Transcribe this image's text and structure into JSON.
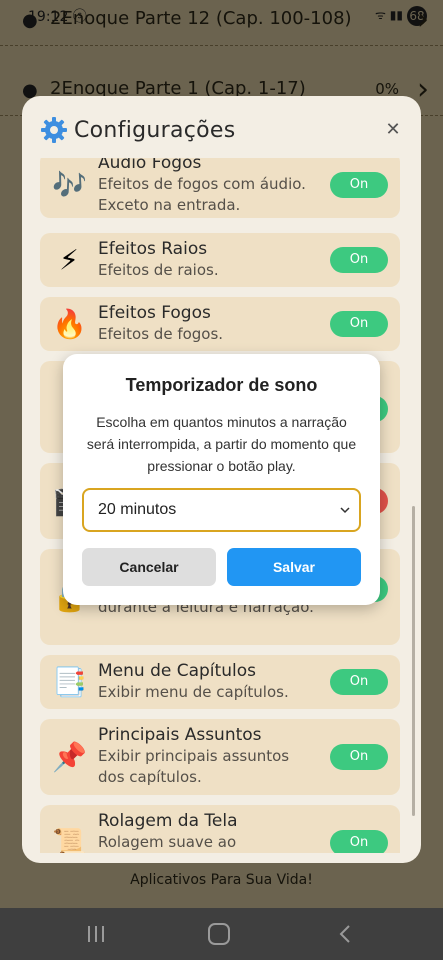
{
  "status_bar": {
    "time": "19:12 ⓢ",
    "icons": "ᯤ ▮▮",
    "battery": "68"
  },
  "background_list": [
    {
      "title": "2Enoque Parte 12 (Cap. 100-108)",
      "percent": ""
    },
    {
      "title": "2Enoque Parte 1 (Cap. 1-17)",
      "percent": "0%"
    }
  ],
  "footer_text": "Aplicativos Para Sua Vida!",
  "settings": {
    "title": "Configurações",
    "close_symbol": "✕",
    "items": [
      {
        "icon": "🎶",
        "name": "Áudio Fogos",
        "desc": "Efeitos de fogos com áudio. Exceto na entrada.",
        "toggle": "On"
      },
      {
        "icon": "⚡",
        "name": "Efeitos Raios",
        "desc": "Efeitos de raios.",
        "toggle": "On"
      },
      {
        "icon": "🔥",
        "name": "Efeitos Fogos",
        "desc": "Efeitos de fogos.",
        "toggle": "On"
      },
      {
        "icon": "",
        "name": "",
        "desc": "",
        "toggle": "On"
      },
      {
        "icon": "🎬",
        "name": "",
        "desc": "",
        "toggle": ""
      },
      {
        "icon": "🔒",
        "name": "",
        "desc": "durante a leitura e narração.",
        "toggle": "On"
      },
      {
        "icon": "📑",
        "name": "Menu de Capítulos",
        "desc": "Exibir menu de capítulos.",
        "toggle": "On"
      },
      {
        "icon": "📌",
        "name": "Principais Assuntos",
        "desc": "Exibir principais assuntos dos capítulos.",
        "toggle": "On"
      },
      {
        "icon": "📜",
        "name": "Rolagem da Tela",
        "desc": "Rolagem suave ao",
        "toggle": "On"
      }
    ]
  },
  "sleep_timer": {
    "title": "Temporizador de sono",
    "description": "Escolha em quantos minutos a narração será interrompida, a partir do momento que pressionar o botão play.",
    "selected_value": "20 minutos",
    "cancel_label": "Cancelar",
    "save_label": "Salvar"
  },
  "colors": {
    "toggle_on": "#3dc980",
    "save_button": "#2196f3",
    "select_border": "#d9a520",
    "item_background": "#efe0c5"
  }
}
